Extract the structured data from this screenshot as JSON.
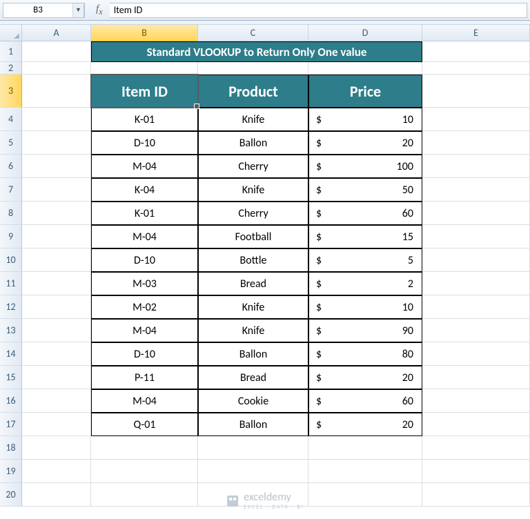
{
  "nameBox": "B3",
  "formula": "Item ID",
  "columns": [
    "A",
    "B",
    "C",
    "D",
    "E"
  ],
  "columnWidths": {
    "A": 100,
    "B": 155,
    "C": 160,
    "D": 165,
    "E": 156
  },
  "selectedColumn": "B",
  "selectedRow": 3,
  "rowCount": 20,
  "rowHeights": {
    "default": 34,
    "r1": 30,
    "r2": 18,
    "r3": 48
  },
  "title": "Standard VLOOKUP to Return Only One value",
  "headers": {
    "item_id": "Item ID",
    "product": "Product",
    "price": "Price"
  },
  "currency": "$",
  "data": [
    {
      "id": "K-01",
      "product": "Knife",
      "price": 10
    },
    {
      "id": "D-10",
      "product": "Ballon",
      "price": 20
    },
    {
      "id": "M-04",
      "product": "Cherry",
      "price": 100
    },
    {
      "id": "K-04",
      "product": "Knife",
      "price": 50
    },
    {
      "id": "K-01",
      "product": "Cherry",
      "price": 60
    },
    {
      "id": "M-04",
      "product": "Football",
      "price": 15
    },
    {
      "id": "D-10",
      "product": "Bottle",
      "price": 5
    },
    {
      "id": "M-03",
      "product": "Bread",
      "price": 2
    },
    {
      "id": "M-02",
      "product": "Knife",
      "price": 10
    },
    {
      "id": "M-04",
      "product": "Knife",
      "price": 90
    },
    {
      "id": "D-10",
      "product": "Ballon",
      "price": 80
    },
    {
      "id": "P-11",
      "product": "Bread",
      "price": 20
    },
    {
      "id": "M-04",
      "product": "Cookie",
      "price": 60
    },
    {
      "id": "Q-01",
      "product": "Ballon",
      "price": 20
    }
  ],
  "watermark": {
    "brand": "exceldemy",
    "sub": "EXCEL · DATA · BI"
  }
}
